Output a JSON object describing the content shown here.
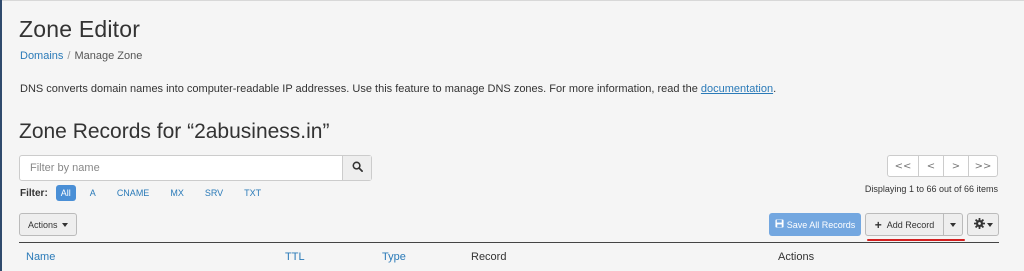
{
  "page": {
    "title": "Zone Editor",
    "breadcrumb": {
      "parent": "Domains",
      "separator": "/",
      "current": "Manage Zone"
    },
    "description": "DNS converts domain names into computer-readable IP addresses. Use this feature to manage DNS zones. For more information, read the ",
    "description_link": "documentation",
    "description_end": "."
  },
  "zone": {
    "title": "Zone Records for “2abusiness.in”"
  },
  "search": {
    "placeholder": "Filter by name",
    "value": ""
  },
  "filter": {
    "label": "Filter:",
    "chips": [
      "All",
      "A",
      "CNAME",
      "MX",
      "SRV",
      "TXT"
    ],
    "active": "All"
  },
  "pagination": {
    "first": "<<",
    "prev": "<",
    "next": ">",
    "last": ">>",
    "summary": "Displaying 1 to 66 out of 66 items"
  },
  "toolbar": {
    "actions_label": "Actions",
    "save_all_label": "Save All Records",
    "add_record_label": "Add Record"
  },
  "table": {
    "columns": [
      "Name",
      "TTL",
      "Type",
      "Record",
      "Actions"
    ]
  },
  "colors": {
    "link": "#2a7ab8",
    "active_chip": "#4a8fd6",
    "save_button": "#73a7e0",
    "highlight_underline": "#d42020"
  },
  "icons": [
    "search-icon",
    "save-icon",
    "plus-icon",
    "caret-down-icon",
    "gear-icon"
  ]
}
